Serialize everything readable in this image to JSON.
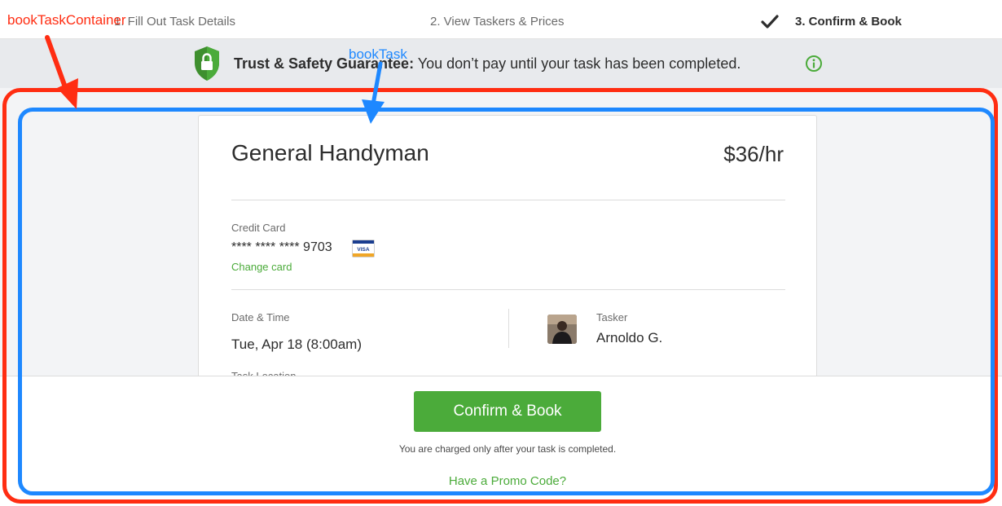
{
  "steps": {
    "step1": "1. Fill Out Task Details",
    "step2": "2. View Taskers & Prices",
    "step3": "3. Confirm & Book"
  },
  "banner": {
    "bold": "Trust & Safety Guarantee:",
    "text": " You don’t pay until your task has been completed."
  },
  "task": {
    "title": "General Handyman",
    "rate": "$36/hr"
  },
  "payment": {
    "label": "Credit Card",
    "number": "**** **** **** 9703",
    "change_link": "Change card",
    "card_brand": "VISA"
  },
  "schedule": {
    "label": "Date & Time",
    "value": "Tue, Apr 18 (8:00am)",
    "location_label": "Task Location"
  },
  "tasker": {
    "label": "Tasker",
    "name": "Arnoldo G."
  },
  "footer": {
    "confirm_label": "Confirm & Book",
    "charge_note": "You are charged only after your task is completed.",
    "promo_link": "Have a Promo Code?"
  },
  "annotations": {
    "container": "bookTaskContainer",
    "task": "bookTask"
  },
  "colors": {
    "accent": "#4bab3a",
    "annotation_red": "#ff2d12",
    "annotation_blue": "#1e88ff"
  }
}
